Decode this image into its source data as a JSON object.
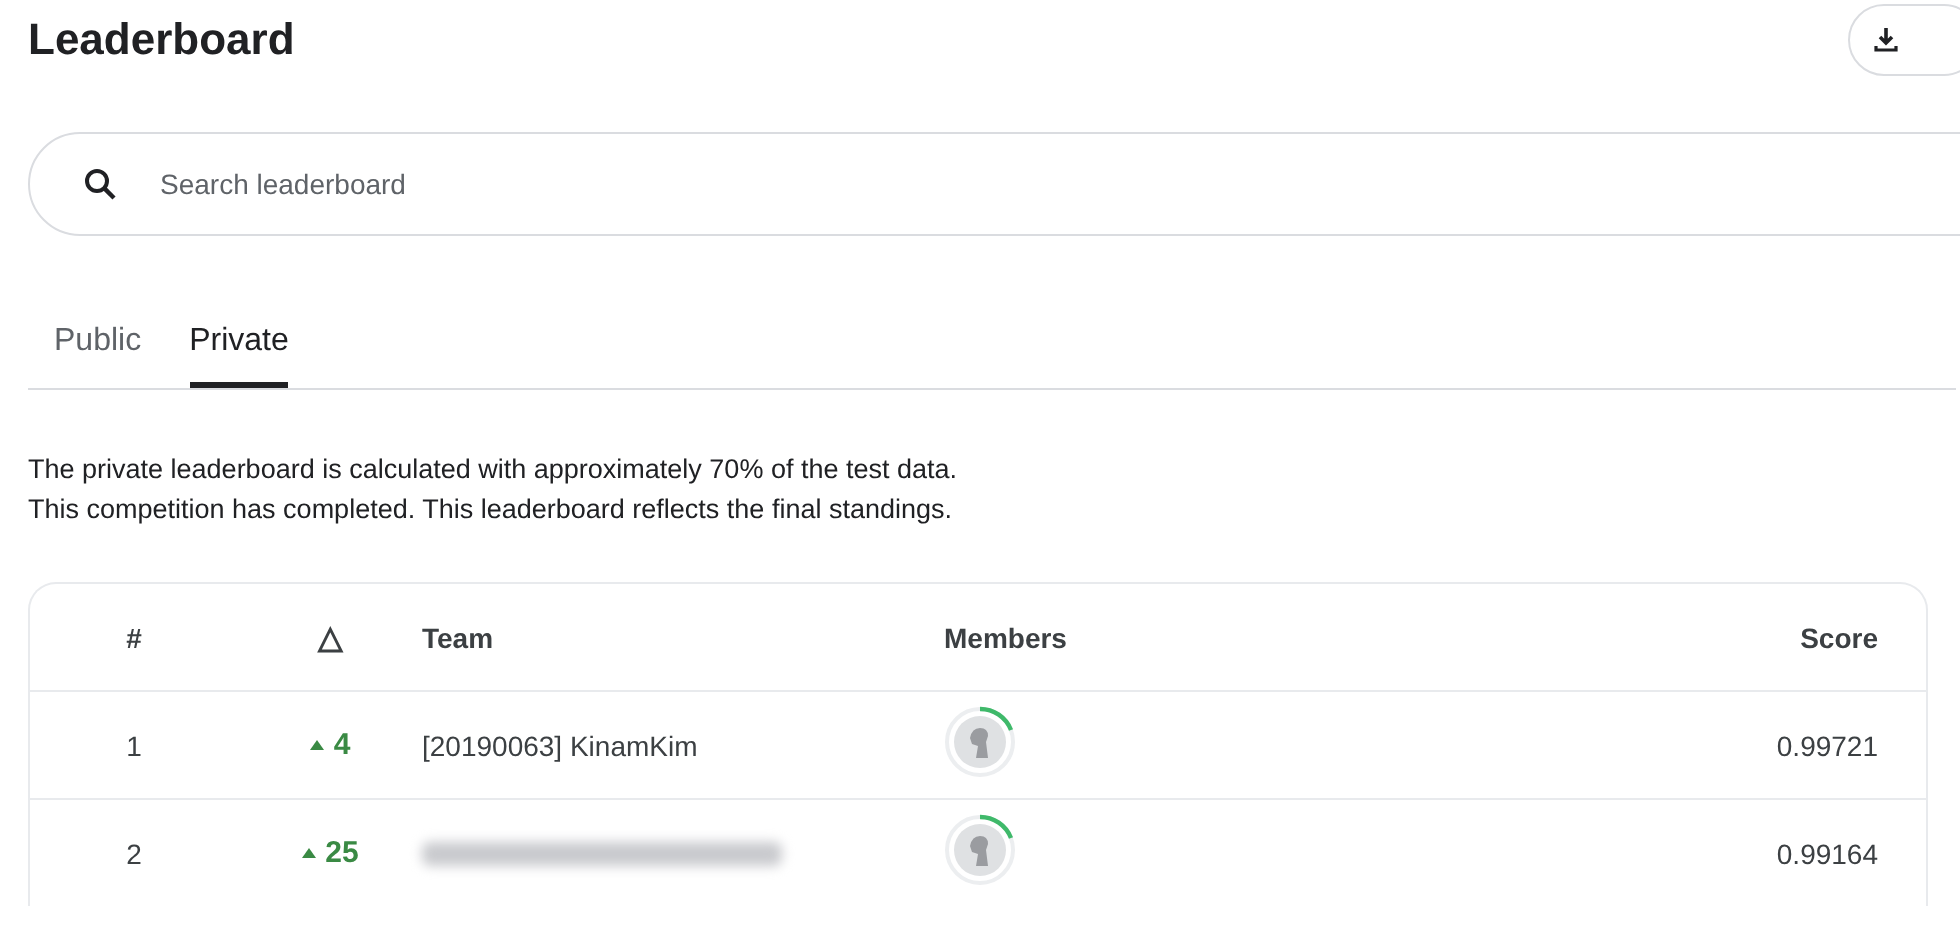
{
  "title": "Leaderboard",
  "search": {
    "placeholder": "Search leaderboard"
  },
  "tabs": [
    {
      "label": "Public",
      "selected": false
    },
    {
      "label": "Private",
      "selected": true
    }
  ],
  "description": [
    "The private leaderboard is calculated with approximately 70% of the test data.",
    "This competition has completed. This leaderboard reflects the final standings."
  ],
  "table": {
    "columns": [
      "#",
      "△",
      "Team",
      "Members",
      "Score"
    ],
    "rows": [
      {
        "rank": "1",
        "change": {
          "up": true,
          "value": "4"
        },
        "team": "[20190063] KinamKim",
        "team_redacted": false,
        "score": "0.99721"
      },
      {
        "rank": "2",
        "change": {
          "up": true,
          "value": "25"
        },
        "team_redacted": true,
        "score": "0.99164"
      }
    ]
  }
}
